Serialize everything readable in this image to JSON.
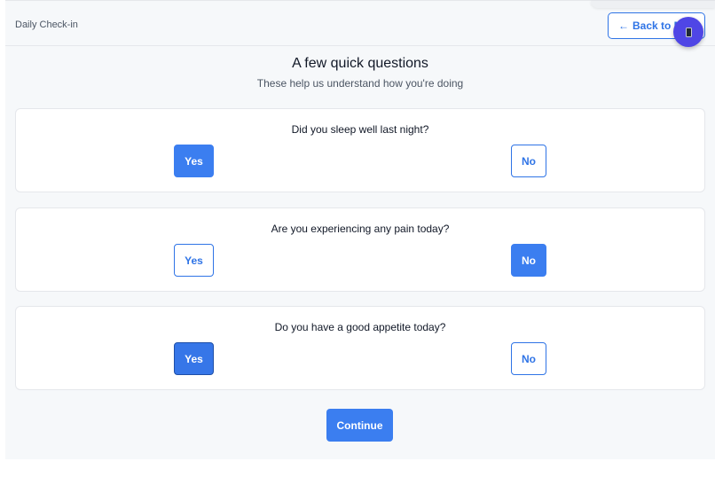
{
  "header": {
    "title": "Daily Check-in",
    "back_arrow": "←",
    "back_label": "Back to M",
    "fab_icon": "phone-icon"
  },
  "intro": {
    "title": "A few quick questions",
    "subtitle": "These help us understand how you're doing"
  },
  "questions": [
    {
      "text": "Did you sleep well last night?",
      "yes_label": "Yes",
      "no_label": "No",
      "selected": "yes"
    },
    {
      "text": "Are you experiencing any pain today?",
      "yes_label": "Yes",
      "no_label": "No",
      "selected": "no"
    },
    {
      "text": "Do you have a good appetite today?",
      "yes_label": "Yes",
      "no_label": "No",
      "selected": "yes"
    }
  ],
  "actions": {
    "continue_label": "Continue"
  },
  "colors": {
    "accent": "#3b7ef0",
    "accent_border": "#2f74e6",
    "fab": "#4f46e5",
    "page_bg": "#f6f8fa"
  }
}
